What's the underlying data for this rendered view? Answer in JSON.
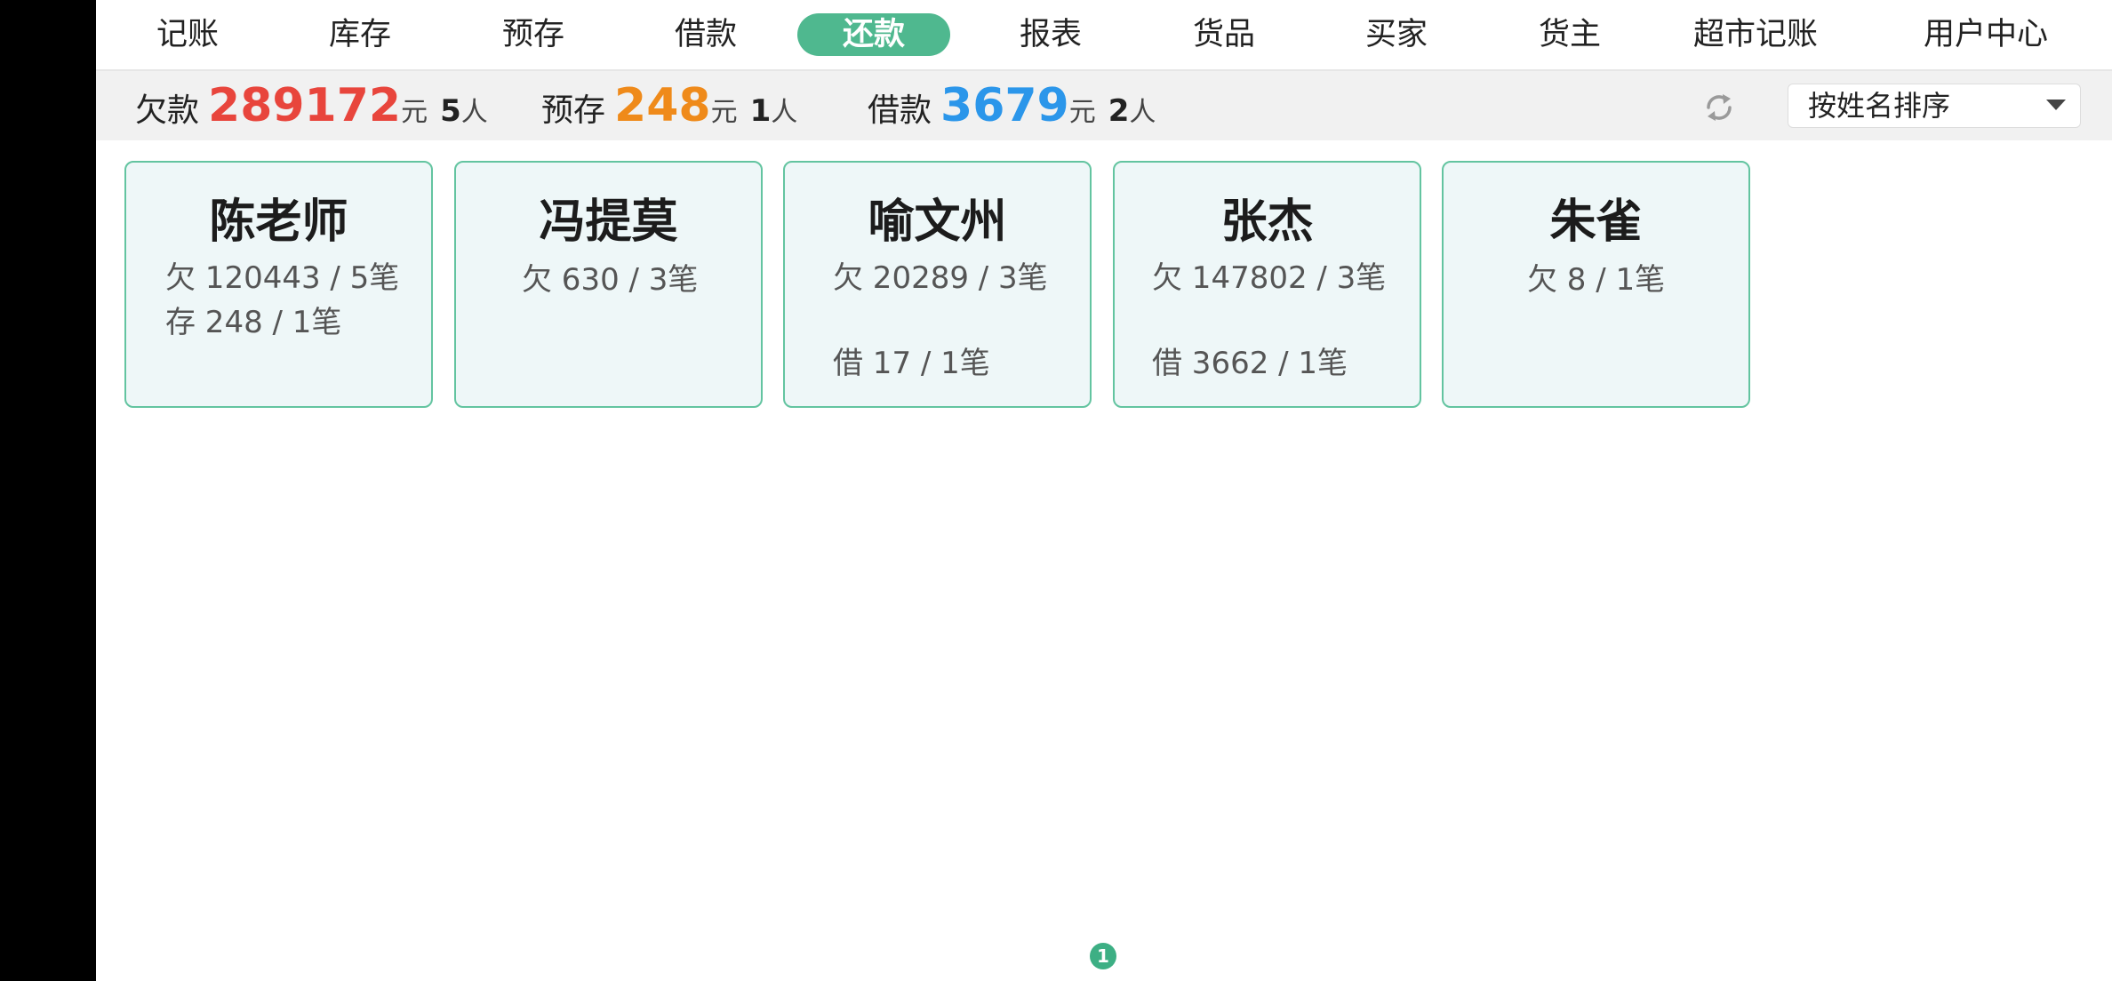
{
  "nav": {
    "items": [
      {
        "label": "记账"
      },
      {
        "label": "库存"
      },
      {
        "label": "预存"
      },
      {
        "label": "借款"
      },
      {
        "label": "还款"
      },
      {
        "label": "报表"
      },
      {
        "label": "货品"
      },
      {
        "label": "买家"
      },
      {
        "label": "货主"
      },
      {
        "label": "超市记账"
      },
      {
        "label": "用户中心"
      }
    ],
    "active_label": "还款"
  },
  "summary": {
    "debt": {
      "label": "欠款",
      "amount": "289172",
      "unit": "元",
      "count": "5",
      "person_unit": "人",
      "color": "#e8453c"
    },
    "deposit": {
      "label": "预存",
      "amount": "248",
      "unit": "元",
      "count": "1",
      "person_unit": "人",
      "color": "#ef8a1a"
    },
    "loan": {
      "label": "借款",
      "amount": "3679",
      "unit": "元",
      "count": "2",
      "person_unit": "人",
      "color": "#2b96ea"
    },
    "refresh_icon": "refresh-icon",
    "sort": {
      "selected": "按姓名排序",
      "icon": "chevron-down-icon"
    }
  },
  "cards": [
    {
      "name": "陈老师",
      "debt": "欠 120443 / 5笔",
      "deposit": "存 248 / 1笔"
    },
    {
      "name": "冯提莫",
      "debt": "欠 630 / 3笔"
    },
    {
      "name": "喻文州",
      "debt": "欠 20289 / 3笔",
      "loan": "借 17 / 1笔"
    },
    {
      "name": "张杰",
      "debt": "欠 147802 / 3笔",
      "loan": "借 3662 / 1笔"
    },
    {
      "name": "朱雀",
      "debt": "欠 8 / 1笔"
    }
  ],
  "pagination": {
    "current": "1"
  }
}
